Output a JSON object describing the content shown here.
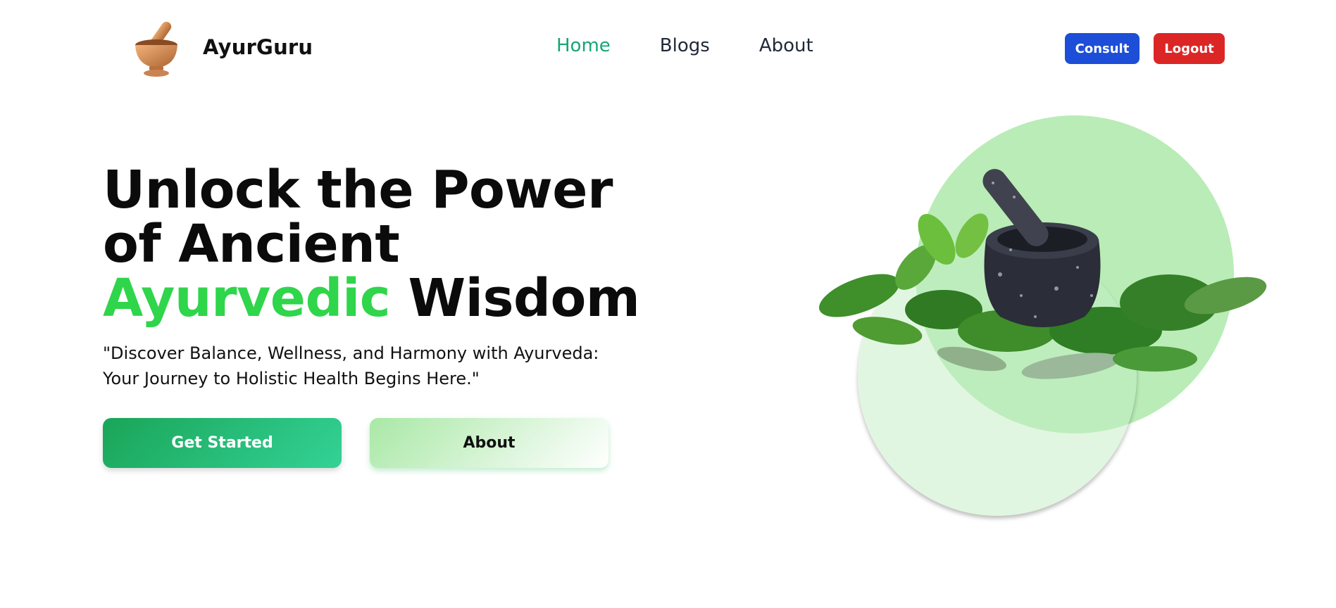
{
  "brand": {
    "name": "AyurGuru",
    "logo_icon": "mortar-pestle-icon"
  },
  "nav": {
    "items": [
      {
        "label": "Home",
        "active": true
      },
      {
        "label": "Blogs",
        "active": false
      },
      {
        "label": "About",
        "active": false
      }
    ],
    "consult_label": "Consult",
    "logout_label": "Logout"
  },
  "hero": {
    "headline_part1": "Unlock the Power of Ancient ",
    "headline_accent": "Ayurvedic",
    "headline_part2": " Wisdom",
    "tagline": "\"Discover Balance, Wellness, and Harmony with Ayurveda: Your Journey to Holistic Health Begins Here.\"",
    "primary_button": "Get Started",
    "secondary_button": "About"
  },
  "illustration": {
    "icon": "mortar-with-herbs-icon"
  },
  "colors": {
    "accent_green": "#2fd54a",
    "active_nav": "#17a673",
    "consult_blue": "#1d4ed8",
    "logout_red": "#dc2626"
  }
}
